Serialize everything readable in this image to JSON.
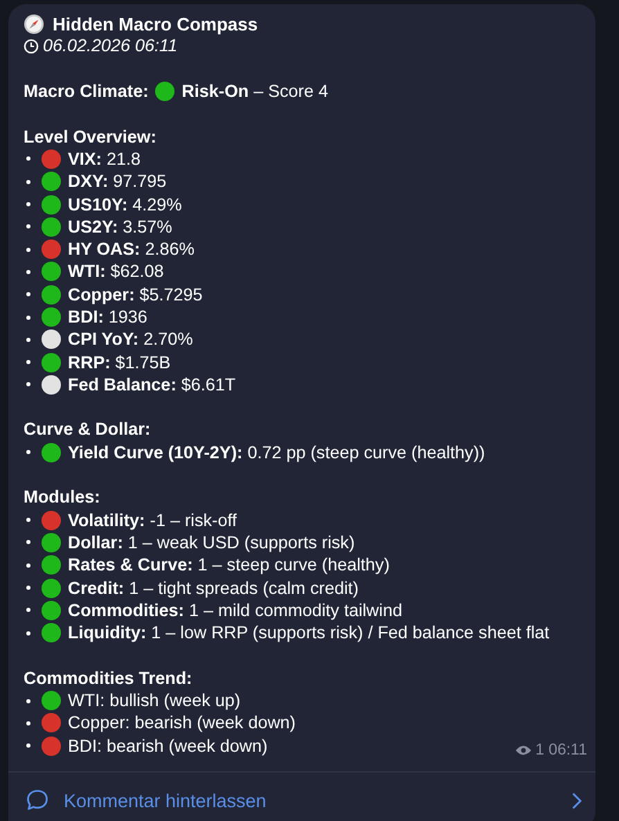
{
  "post": {
    "title": "Hidden Macro Compass",
    "date": "06.02.2026 06:11"
  },
  "climate": {
    "label": "Macro Climate:",
    "color": "#1fb81a",
    "text": "**Risk-On** – Score 4"
  },
  "sections": [
    {
      "heading": "Level Overview:",
      "items": [
        {
          "color": "#d8332b",
          "text": "**VIX:** 21.8"
        },
        {
          "color": "#1fb81a",
          "text": "**DXY:** 97.795"
        },
        {
          "color": "#1fb81a",
          "text": "**US10Y:** 4.29%"
        },
        {
          "color": "#1fb81a",
          "text": "**US2Y:** 3.57%"
        },
        {
          "color": "#d8332b",
          "text": "**HY OAS:** 2.86%"
        },
        {
          "color": "#1fb81a",
          "text": "**WTI:** $62.08"
        },
        {
          "color": "#1fb81a",
          "text": "**Copper:** $5.7295"
        },
        {
          "color": "#1fb81a",
          "text": "**BDI:** 1936"
        },
        {
          "color": "#e2e2e2",
          "text": "**CPI YoY:** 2.70%"
        },
        {
          "color": "#1fb81a",
          "text": "**RRP:** $1.75B"
        },
        {
          "color": "#e2e2e2",
          "text": "**Fed Balance:** $6.61T"
        }
      ]
    },
    {
      "heading": "Curve & Dollar:",
      "items": [
        {
          "color": "#1fb81a",
          "text": "**Yield Curve (10Y-2Y):** 0.72 pp (steep curve (healthy))"
        }
      ]
    },
    {
      "heading": "Modules:",
      "items": [
        {
          "color": "#d8332b",
          "text": "**Volatility:** -1 – risk-off"
        },
        {
          "color": "#1fb81a",
          "text": "**Dollar:** 1 – weak USD (supports risk)"
        },
        {
          "color": "#1fb81a",
          "text": "**Rates & Curve:** 1 – steep curve (healthy)"
        },
        {
          "color": "#1fb81a",
          "text": "**Credit:** 1 – tight spreads (calm credit)"
        },
        {
          "color": "#1fb81a",
          "text": "**Commodities:** 1 – mild commodity tailwind"
        },
        {
          "color": "#1fb81a",
          "text": "**Liquidity:** 1 – low RRP (supports risk) / Fed balance sheet flat"
        }
      ]
    },
    {
      "heading": "Commodities Trend:",
      "items": [
        {
          "color": "#1fb81a",
          "text": "WTI: bullish (week up)"
        },
        {
          "color": "#d8332b",
          "text": "Copper: bearish (week down)"
        },
        {
          "color": "#d8332b",
          "text": "BDI: bearish (week down)"
        }
      ]
    }
  ],
  "meta": {
    "views": "1",
    "time": "06:11"
  },
  "comment": {
    "label": "Kommentar hinterlassen"
  }
}
